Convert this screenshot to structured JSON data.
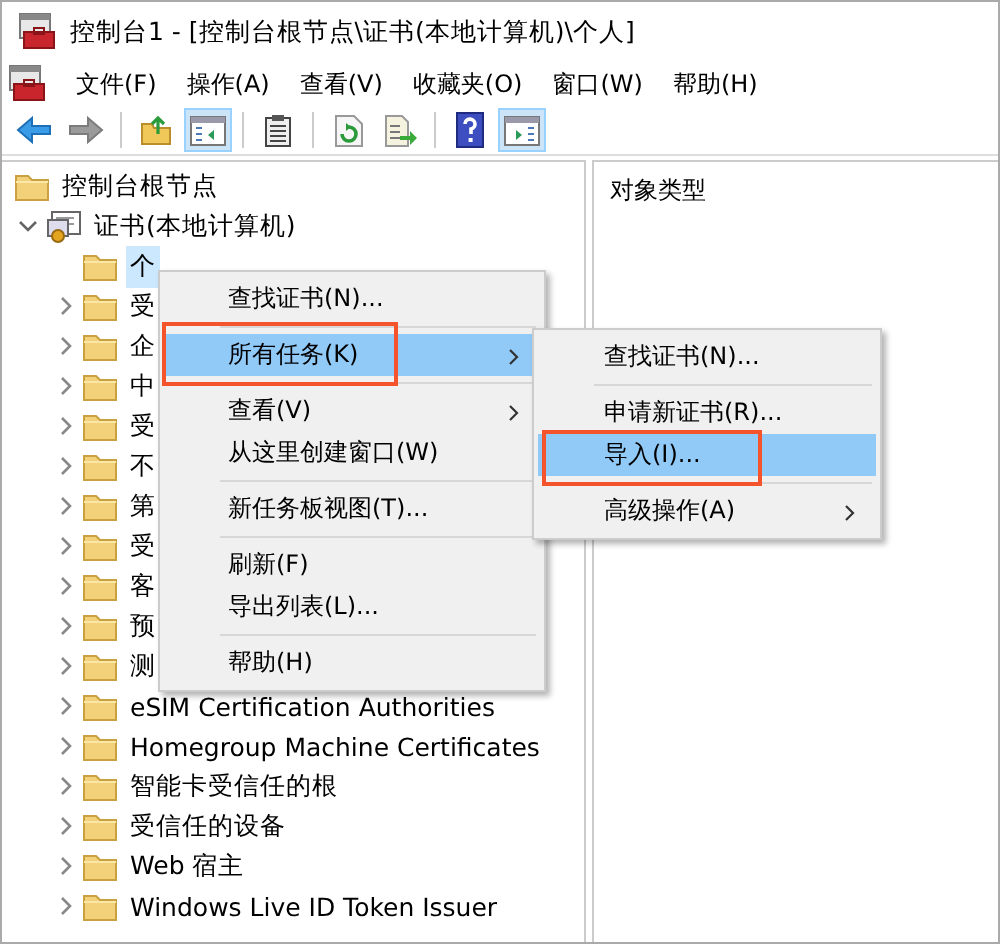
{
  "window": {
    "title": "控制台1 - [控制台根节点\\证书(本地计算机)\\个人]"
  },
  "menu_bar": [
    "文件(F)",
    "操作(A)",
    "查看(V)",
    "收藏夹(O)",
    "窗口(W)",
    "帮助(H)"
  ],
  "toolbar": [
    {
      "kind": "back",
      "pressed": false,
      "disabled": false
    },
    {
      "kind": "forward",
      "pressed": false,
      "disabled": true
    },
    {
      "kind": "separator"
    },
    {
      "kind": "up",
      "pressed": false,
      "disabled": false
    },
    {
      "kind": "tree-pane",
      "pressed": true,
      "disabled": false
    },
    {
      "kind": "separator"
    },
    {
      "kind": "properties",
      "pressed": false,
      "disabled": false
    },
    {
      "kind": "separator"
    },
    {
      "kind": "refresh",
      "pressed": false,
      "disabled": false
    },
    {
      "kind": "export",
      "pressed": false,
      "disabled": false
    },
    {
      "kind": "separator"
    },
    {
      "kind": "help",
      "pressed": false,
      "disabled": false
    },
    {
      "kind": "action-pane",
      "pressed": true,
      "disabled": false
    }
  ],
  "tree": [
    {
      "label": "控制台根节点",
      "kind": "root",
      "children": [
        {
          "label": "证书(本地计算机)",
          "kind": "certificates",
          "expanded": true,
          "children": [
            {
              "label": "个",
              "kind": "folder",
              "selected": true,
              "expandable": false
            },
            {
              "label": "受",
              "kind": "folder",
              "selected": false,
              "expandable": true
            },
            {
              "label": "企",
              "kind": "folder",
              "selected": false,
              "expandable": true
            },
            {
              "label": "中",
              "kind": "folder",
              "selected": false,
              "expandable": true
            },
            {
              "label": "受",
              "kind": "folder",
              "selected": false,
              "expandable": true
            },
            {
              "label": "不",
              "kind": "folder",
              "selected": false,
              "expandable": true
            },
            {
              "label": "第",
              "kind": "folder",
              "selected": false,
              "expandable": true
            },
            {
              "label": "受",
              "kind": "folder",
              "selected": false,
              "expandable": true
            },
            {
              "label": "客",
              "kind": "folder",
              "selected": false,
              "expandable": true
            },
            {
              "label": "预",
              "kind": "folder",
              "selected": false,
              "expandable": true
            },
            {
              "label": "测",
              "kind": "folder",
              "selected": false,
              "expandable": true
            },
            {
              "label": "eSIM Certification Authorities",
              "kind": "folder",
              "selected": false,
              "expandable": true
            },
            {
              "label": "Homegroup Machine Certificates",
              "kind": "folder",
              "selected": false,
              "expandable": true
            },
            {
              "label": "智能卡受信任的根",
              "kind": "folder",
              "selected": false,
              "expandable": true
            },
            {
              "label": "受信任的设备",
              "kind": "folder",
              "selected": false,
              "expandable": true
            },
            {
              "label": "Web 宿主",
              "kind": "folder",
              "selected": false,
              "expandable": true
            },
            {
              "label": "Windows Live ID Token Issuer",
              "kind": "folder",
              "selected": false,
              "expandable": true
            }
          ]
        }
      ]
    }
  ],
  "details": {
    "column_header": "对象类型"
  },
  "context_menu": [
    {
      "kind": "item",
      "label": "查找证书(N)...",
      "selected": false,
      "submenu": false,
      "annotated": false
    },
    {
      "kind": "separator"
    },
    {
      "kind": "item",
      "label": "所有任务(K)",
      "selected": true,
      "submenu": true,
      "annotated": true
    },
    {
      "kind": "separator"
    },
    {
      "kind": "item",
      "label": "查看(V)",
      "selected": false,
      "submenu": true,
      "annotated": false
    },
    {
      "kind": "item",
      "label": "从这里创建窗口(W)",
      "selected": false,
      "submenu": false,
      "annotated": false
    },
    {
      "kind": "separator"
    },
    {
      "kind": "item",
      "label": "新任务板视图(T)...",
      "selected": false,
      "submenu": false,
      "annotated": false
    },
    {
      "kind": "separator"
    },
    {
      "kind": "item",
      "label": "刷新(F)",
      "selected": false,
      "submenu": false,
      "annotated": false
    },
    {
      "kind": "item",
      "label": "导出列表(L)...",
      "selected": false,
      "submenu": false,
      "annotated": false
    },
    {
      "kind": "separator"
    },
    {
      "kind": "item",
      "label": "帮助(H)",
      "selected": false,
      "submenu": false,
      "annotated": false
    }
  ],
  "submenu": [
    {
      "kind": "item",
      "label": "查找证书(N)...",
      "selected": false,
      "submenu": false,
      "annotated": false
    },
    {
      "kind": "separator"
    },
    {
      "kind": "item",
      "label": "申请新证书(R)...",
      "selected": false,
      "submenu": false,
      "annotated": false
    },
    {
      "kind": "item",
      "label": "导入(I)...",
      "selected": true,
      "submenu": false,
      "annotated": true
    },
    {
      "kind": "separator"
    },
    {
      "kind": "item",
      "label": "高级操作(A)",
      "selected": false,
      "submenu": true,
      "annotated": false
    }
  ]
}
